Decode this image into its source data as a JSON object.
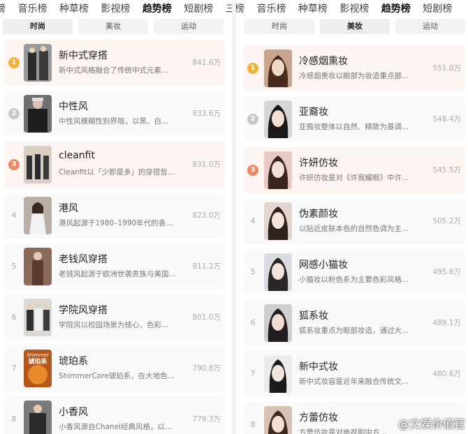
{
  "tabs_left": [
    "榜",
    "音乐榜",
    "种草榜",
    "影视榜",
    "趋势榜",
    "短剧榜",
    "三"
  ],
  "tabs_right": [
    "榜",
    "音乐榜",
    "种草榜",
    "影视榜",
    "趋势榜",
    "短剧榜"
  ],
  "active_tab": "趋势榜",
  "subtabs": [
    "时尚",
    "美妆",
    "运动"
  ],
  "left": {
    "active_subtab": "时尚",
    "items": [
      {
        "rank": "1",
        "title": "新中式穿搭",
        "desc": "新中式风格融合了传统中式元素...",
        "heat": "841.6万"
      },
      {
        "rank": "2",
        "title": "中性风",
        "desc": "中性风模糊性别界限，以黑、白...",
        "heat": "833.6万"
      },
      {
        "rank": "3",
        "title": "cleanfit",
        "desc": "Cleanfit以「少即是多」的穿搭哲...",
        "heat": "831.0万"
      },
      {
        "rank": "4",
        "title": "港风",
        "desc": "港风起源于1980–1990年代的香...",
        "heat": "823.0万"
      },
      {
        "rank": "5",
        "title": "老钱风穿搭",
        "desc": "老钱风起源于欧洲世袭贵族与美国...",
        "heat": "811.2万"
      },
      {
        "rank": "6",
        "title": "学院风穿搭",
        "desc": "学院风以校园场景为核心，色彩...",
        "heat": "801.0万"
      },
      {
        "rank": "7",
        "title": "琥珀系",
        "desc": "ShimmerCore琥珀系，在大地色...",
        "heat": "790.8万"
      },
      {
        "rank": "8",
        "title": "小香风",
        "desc": "小香风源自Chanel经典风格，以...",
        "heat": "779.3万"
      }
    ]
  },
  "right": {
    "active_subtab": "美妆",
    "items": [
      {
        "rank": "1",
        "title": "冷感烟熏妆",
        "desc": "冷感烟熏妆以眼部为妆造重点部...",
        "heat": "551.0万"
      },
      {
        "rank": "2",
        "title": "亚裔妆",
        "desc": "亚裔妆整体以自然、精致为基调...",
        "heat": "548.4万"
      },
      {
        "rank": "3",
        "title": "许妍仿妆",
        "desc": "许妍仿妆是对《许我耀眼》中许...",
        "heat": "545.5万"
      },
      {
        "rank": "4",
        "title": "伪素颜妆",
        "desc": "以贴近皮肤本色的自然色调为主...",
        "heat": "505.2万"
      },
      {
        "rank": "5",
        "title": "网感小猫妆",
        "desc": "小猫妆以粉色系为主要色彩风格...",
        "heat": "495.8万"
      },
      {
        "rank": "6",
        "title": "狐系妆",
        "desc": "狐系妆重点为眼部妆造，通过大...",
        "heat": "489.1万"
      },
      {
        "rank": "7",
        "title": "新中式妆",
        "desc": "新中式妆容是近年来融合传统文...",
        "heat": "480.6万"
      },
      {
        "rank": "8",
        "title": "方蕾仿妆",
        "desc": "方蕾仿妆是对电视剧中方...",
        "heat": "474.0万"
      }
    ]
  },
  "thumb_text": {
    "l7_top": "Shimmer",
    "l7_main": "琥珀系"
  },
  "watermark": "@文娱价值官",
  "colors": {
    "gold": "#f0b23a",
    "silver": "#c8c8cc",
    "bronze": "#e78866",
    "top_bg": "#fdf5f2",
    "row_bg": "#fafafa"
  }
}
